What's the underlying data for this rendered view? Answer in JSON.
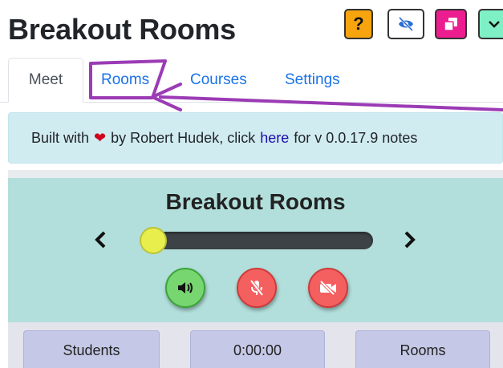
{
  "header": {
    "title": "Breakout Rooms",
    "help_label": "?"
  },
  "tabs": [
    {
      "label": "Meet",
      "active": true
    },
    {
      "label": "Rooms",
      "active": false
    },
    {
      "label": "Courses",
      "active": false
    },
    {
      "label": "Settings",
      "active": false
    }
  ],
  "notice": {
    "prefix": "Built with",
    "by_text": "by Robert Hudek, click",
    "link_text": "here",
    "suffix": "for v 0.0.17.9 notes"
  },
  "panel": {
    "title": "Breakout Rooms",
    "prev_symbol": "<",
    "next_symbol": ">",
    "slider_level": 0
  },
  "bottom_bar": {
    "students_label": "Students",
    "timer": "0:00:00",
    "rooms_label": "Rooms"
  },
  "colors": {
    "help_button": "#f7a40f",
    "popout_button": "#ec1d8f",
    "collapse_button": "#7ff0c6",
    "notice_bg": "#d1ecf1",
    "panel_bg": "#b2dfdb",
    "slider_thumb": "#e8ee4c",
    "speaker_on": "#77d66f",
    "muted_red": "#f46060",
    "pill_bg": "#c5c8e6",
    "annotation_purple": "#9b3bb5"
  },
  "icons": {
    "help": "question-mark-icon",
    "visibility": "eye-off-icon",
    "popout": "popout-window-icon",
    "collapse": "chevron-down-icon",
    "speaker": "speaker-volume-icon",
    "mic": "mic-muted-icon",
    "camera": "camera-off-icon",
    "heart": "heart-icon"
  }
}
